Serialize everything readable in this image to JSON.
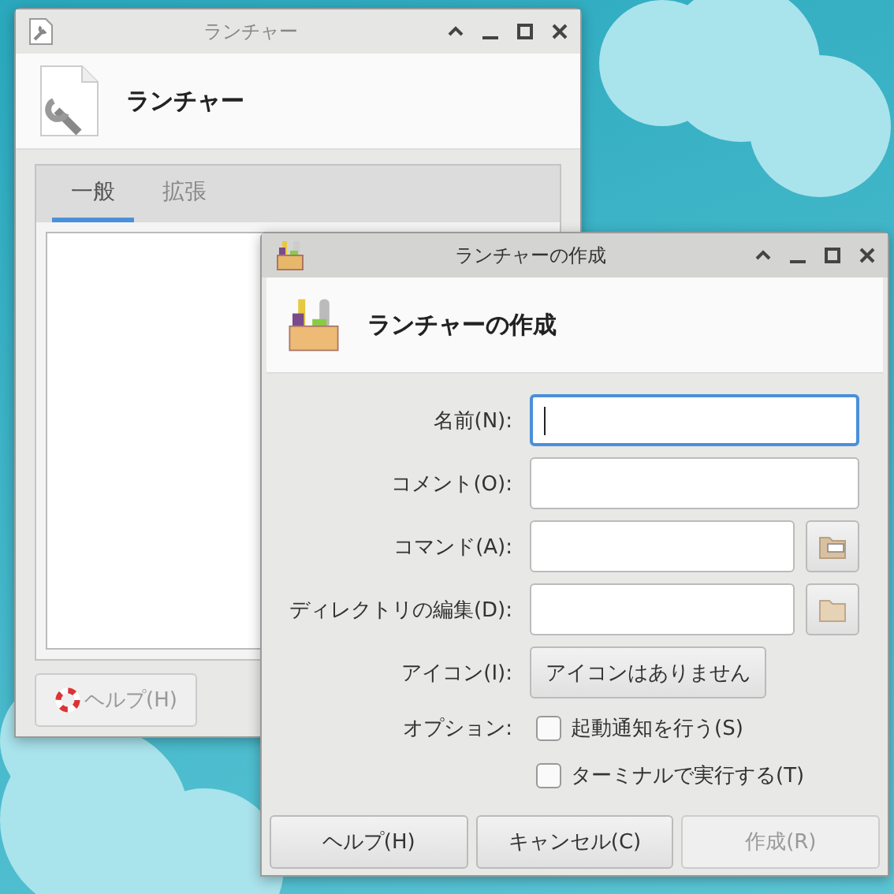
{
  "back_window": {
    "title": "ランチャー",
    "header": "ランチャー",
    "tabs": [
      {
        "label": "一般",
        "selected": true
      },
      {
        "label": "拡張",
        "selected": false
      }
    ],
    "help_button": {
      "label": "ヘルプ(H)",
      "disabled": true
    }
  },
  "dialog": {
    "title": "ランチャーの作成",
    "header": "ランチャーの作成",
    "fields": [
      {
        "label": "名前(N):",
        "focused": true,
        "kind": "plain"
      },
      {
        "label": "コメント(O):",
        "focused": false,
        "kind": "plain"
      },
      {
        "label": "コマンド(A):",
        "focused": false,
        "kind": "file"
      },
      {
        "label": "ディレクトリの編集(D):",
        "focused": false,
        "kind": "folder"
      }
    ],
    "icon_row": {
      "label": "アイコン(I):",
      "button": "アイコンはありません"
    },
    "options_label": "オプション:",
    "options": [
      {
        "label": "起動通知を行う(S)",
        "checked": false
      },
      {
        "label": "ターミナルで実行する(T)",
        "checked": false
      }
    ],
    "buttons": [
      {
        "label": "ヘルプ(H)",
        "disabled": false
      },
      {
        "label": "キャンセル(C)",
        "disabled": false
      },
      {
        "label": "作成(R)",
        "disabled": true
      }
    ]
  }
}
